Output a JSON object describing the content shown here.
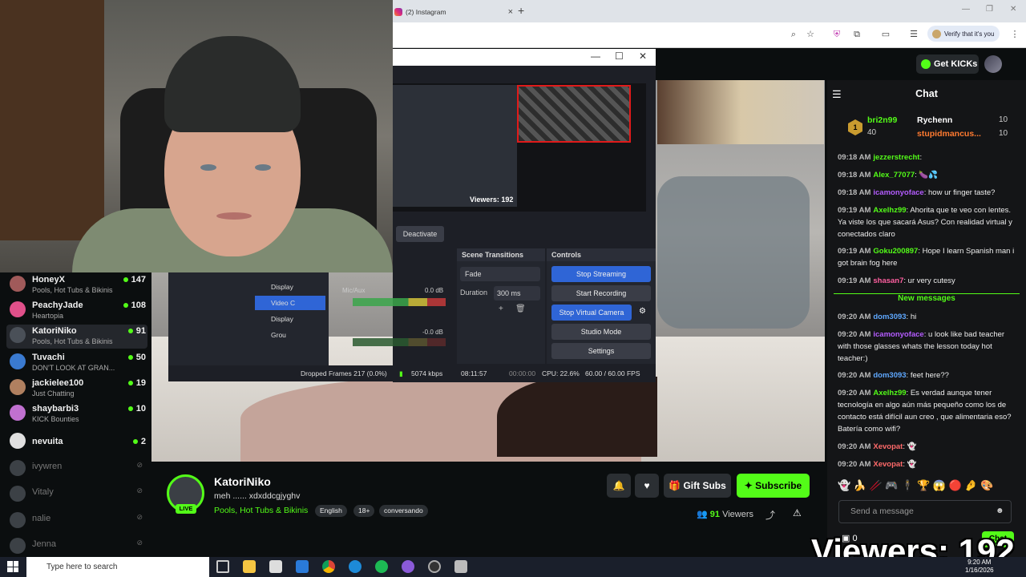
{
  "browser": {
    "tab_title": "(2) Instagram",
    "new_tab": "+",
    "verify_text": "Verify that it's you"
  },
  "kick": {
    "get_kicks": "Get KICKs"
  },
  "obs": {
    "viewers_overlay": "Viewers: 192",
    "deactivate": "Deactivate",
    "scene_transitions_title": "Scene Transitions",
    "controls_title": "Controls",
    "transition": "Fade",
    "duration_label": "Duration",
    "duration_value": "300 ms",
    "controls": [
      "Stop Streaming",
      "Start Recording",
      "Stop Virtual Camera",
      "Studio Mode",
      "Settings"
    ],
    "sources": [
      "Display",
      "Video C",
      "Display",
      "Grou"
    ],
    "mixer_mic": "Mic/Aux",
    "mixer_mic_db": "0.0 dB",
    "mixer_zero_db": "-0.0 dB",
    "status": {
      "dropped": "Dropped Frames 217 (0.0%)",
      "bitrate": "5074 kbps",
      "stream_time": "08:11:57",
      "rec_time": "00:00:00",
      "cpu": "CPU: 22.6%",
      "fps": "60.00 / 60.00 FPS"
    }
  },
  "sidebar": {
    "channels": [
      {
        "name": "HoneyX",
        "category": "Pools, Hot Tubs & Bikinis",
        "viewers": "147",
        "color": "#a05a5a"
      },
      {
        "name": "PeachyJade",
        "category": "Heartopia",
        "viewers": "108",
        "color": "#e0508a"
      },
      {
        "name": "KatoriNiko",
        "category": "Pools, Hot Tubs & Bikinis",
        "viewers": "91",
        "color": "#4a5058"
      },
      {
        "name": "Tuvachi",
        "category": "DON'T LOOK AT GRAN...",
        "viewers": "50",
        "color": "#3a7ad0"
      },
      {
        "name": "jackielee100",
        "category": "Just Chatting",
        "viewers": "19",
        "color": "#b08060"
      },
      {
        "name": "shaybarbi3",
        "category": "KICK Bounties",
        "viewers": "10",
        "color": "#c070d0"
      },
      {
        "name": "nevuita",
        "category": "",
        "viewers": "2",
        "color": "#e0e0e0"
      }
    ],
    "offline": [
      "ivywren",
      "Vitaly",
      "nalie",
      "Jenna"
    ]
  },
  "stream": {
    "streamer": "KatoriNiko",
    "live": "LIVE",
    "title": "meh     ...... xdxddcgjyghv",
    "category": "Pools, Hot Tubs & Bikinis",
    "tags": [
      "English",
      "18+",
      "conversando"
    ],
    "gift_subs": "Gift Subs",
    "subscribe": "Subscribe",
    "viewers_number": "91",
    "viewers_label": "Viewers"
  },
  "chat": {
    "title": "Chat",
    "leaderboard": {
      "rank": "1",
      "first_name": "bri2n99",
      "first_value": "40",
      "second_name": "Rychenn",
      "second_value": "10",
      "third_name": "stupidmancus...",
      "third_value": "10"
    },
    "messages_before": [
      {
        "time": "09:18 AM",
        "user": "jezzerstrecht",
        "text": "",
        "color": "#53fc18"
      },
      {
        "time": "09:18 AM",
        "user": "Alex_77077",
        "text": "🍆💦",
        "color": "#53fc18"
      },
      {
        "time": "09:18 AM",
        "user": "icamonyoface",
        "text": "how ur finger taste?",
        "color": "#b45cff"
      },
      {
        "time": "09:19 AM",
        "user": "Axelhz99",
        "text": "Ahorita que te veo con lentes. Ya viste los que sacará Asus? Con realidad virtual y conectados claro",
        "color": "#53fc18"
      },
      {
        "time": "09:19 AM",
        "user": "Goku200897",
        "text": "Hope I learn Spanish man i got brain fog here",
        "color": "#53fc18"
      },
      {
        "time": "09:19 AM",
        "user": "shasan7",
        "text": "ur very cutesy",
        "color": "#ff5fa0"
      }
    ],
    "new_messages_label": "New messages",
    "messages_after": [
      {
        "time": "09:20 AM",
        "user": "dom3093",
        "text": "hi",
        "color": "#5fa8ff"
      },
      {
        "time": "09:20 AM",
        "user": "icamonyoface",
        "text": "u look like bad teacher with those glasses whats the lesson today hot teacher:)",
        "color": "#b45cff"
      },
      {
        "time": "09:20 AM",
        "user": "dom3093",
        "text": "feet here??",
        "color": "#5fa8ff"
      },
      {
        "time": "09:20 AM",
        "user": "Axelhz99",
        "text": "Es verdad aunque tener tecnología en algo aún más pequeño como los de contacto está difícil aun creo , que alimentaria eso? Batería como wifi?",
        "color": "#53fc18"
      },
      {
        "time": "09:20 AM",
        "user": "Xevopat",
        "text": "👻",
        "color": "#ff6a6a"
      },
      {
        "time": "09:20 AM",
        "user": "Xevopat",
        "text": "👻",
        "color": "#ff6a6a"
      }
    ],
    "emotes": "👻 🍌 🥢 🎮 🕴 🏆 😱 🔴 🤌 🎨",
    "input_placeholder": "Send a message",
    "footer_count": "0",
    "chat_button": "Chat"
  },
  "taskbar": {
    "search_placeholder": "Type here to search",
    "time": "9:20 AM",
    "date": "1/16/2026"
  }
}
